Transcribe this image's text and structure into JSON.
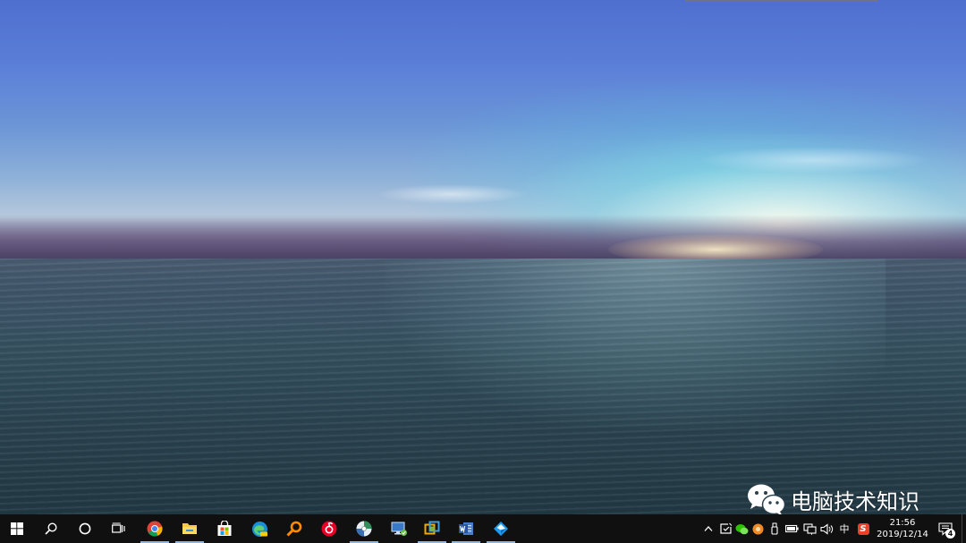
{
  "watermark": {
    "text": "电脑技术知识"
  },
  "taskbar": {
    "pinned_apps": [
      {
        "id": "chrome",
        "icon": "chrome-icon",
        "running": true
      },
      {
        "id": "file-explorer",
        "icon": "folder-icon",
        "running": true
      },
      {
        "id": "store",
        "icon": "store-bag-icon",
        "running": false
      },
      {
        "id": "edge",
        "icon": "edge-icon",
        "running": false
      },
      {
        "id": "search-tool",
        "icon": "magnifier-app-icon",
        "running": false
      },
      {
        "id": "netease-music",
        "icon": "music-icon",
        "running": false
      },
      {
        "id": "globe-app",
        "icon": "globe-icon",
        "running": true
      },
      {
        "id": "remote-desktop",
        "icon": "remote-desktop-icon",
        "running": false
      },
      {
        "id": "virtual-machine",
        "icon": "vm-icon",
        "running": true
      },
      {
        "id": "word",
        "icon": "word-icon",
        "running": true
      },
      {
        "id": "dingtalk",
        "icon": "diamond-app-icon",
        "running": true
      }
    ],
    "tray": {
      "ime": "中",
      "sogou": "S",
      "time": "21:56",
      "date": "2019/12/14",
      "notification_count": "4"
    }
  },
  "colors": {
    "taskbar": "#101010",
    "running_indicator": "#8fb4e6",
    "chrome_red": "#db4437",
    "chrome_yellow": "#f4b400",
    "chrome_green": "#0f9d58",
    "chrome_blue": "#4285f4",
    "folder": "#f8c844",
    "word_blue": "#2b579a"
  }
}
